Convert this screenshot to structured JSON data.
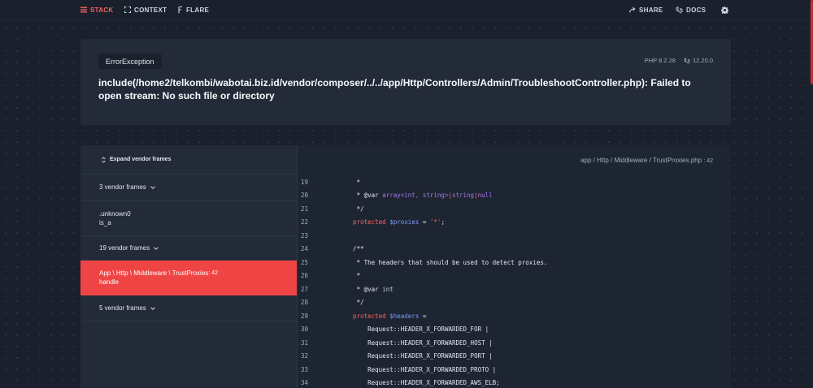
{
  "nav": {
    "stack": "STACK",
    "context": "CONTEXT",
    "flare": "FLARE",
    "share": "SHARE",
    "docs": "DOCS"
  },
  "error": {
    "exception": "ErrorException",
    "php_version": "PHP 8.2.28",
    "laravel_version": "12.20.0",
    "message": "include(/home2/telkombi/wabotai.biz.id/vendor/composer/../../app/Http/Controllers/Admin/TroubleshootController.php): Failed to open stream: No such file or directory"
  },
  "frames": {
    "expand_label": "Expand vendor frames",
    "rows": [
      {
        "label": "3 vendor frames"
      },
      {
        "label": ".unknown0",
        "sub": "is_a"
      },
      {
        "label": "19 vendor frames"
      },
      {
        "label": "App \\ Http \\ Middleware \\ TrustProxies",
        "line": ": 42",
        "sub": "handle"
      },
      {
        "label": "5 vendor frames"
      }
    ]
  },
  "code": {
    "file": "app / Http / Middleware / TrustProxies.php",
    "file_line": ": 42",
    "lines": [
      {
        "n": "19"
      },
      {
        "n": "20"
      },
      {
        "n": "21"
      },
      {
        "n": "22"
      },
      {
        "n": "23"
      },
      {
        "n": "24"
      },
      {
        "n": "25"
      },
      {
        "n": "26"
      },
      {
        "n": "27"
      },
      {
        "n": "28"
      },
      {
        "n": "29"
      },
      {
        "n": "30"
      },
      {
        "n": "31"
      },
      {
        "n": "32"
      },
      {
        "n": "33"
      },
      {
        "n": "34"
      }
    ],
    "tokens": {
      "l19": "     *",
      "l20a": "     * @var ",
      "l20b": "array<int, string>",
      "l20c": "|",
      "l20d": "string",
      "l20e": "|",
      "l20f": "null",
      "l21": "     */",
      "l22a": "    protected ",
      "l22b": "$proxies",
      "l22c": " = ",
      "l22d": "'*'",
      "l22e": ";",
      "l24": "    /**",
      "l25": "     * The headers that should be used to detect proxies.",
      "l26": "     *",
      "l27a": "     * @var ",
      "l27b": "int",
      "l28": "     */",
      "l29a": "    protected ",
      "l29b": "$headers",
      "l29c": " =",
      "l30": "        Request::HEADER_X_FORWARDED_FOR |",
      "l31": "        Request::HEADER_X_FORWARDED_HOST |",
      "l32": "        Request::HEADER_X_FORWARDED_PORT |",
      "l33": "        Request::HEADER_X_FORWARDED_PROTO |",
      "l34": "        Request::HEADER_X_FORWARDED_AWS_ELB;"
    }
  },
  "colors": {
    "accent": "#ef4444",
    "background": "#1a202c",
    "card": "#232a38"
  }
}
